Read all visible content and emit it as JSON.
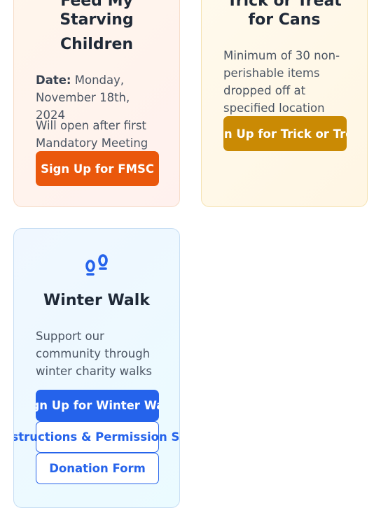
{
  "cards": {
    "fmsc": {
      "title_line1": "Feed My",
      "title_line2": "Starving",
      "title_line3": "Children",
      "date_label": "Date:",
      "date_value": "Monday, November 18th, 2024",
      "note": "Will open after first Mandatory Meeting",
      "button_label": "Sign Up for FMSC"
    },
    "cans": {
      "title_line1": "Trick or Treat",
      "title_line2": "for Cans",
      "description": "Minimum of 30 non-perishable items dropped off at specified location",
      "button_label": "Sign Up for Trick or Treat"
    },
    "walk": {
      "icon": "footprints-icon",
      "title": "Winter Walk",
      "description": "Support our community through winter charity walks",
      "signup_button": "Sign Up for Winter Walk",
      "instructions_button": "Instructions & Permission Slip",
      "donation_button": "Donation Form"
    }
  },
  "colors": {
    "orange": "#ea580c",
    "amber": "#ca8a04",
    "blue": "#2563eb"
  }
}
